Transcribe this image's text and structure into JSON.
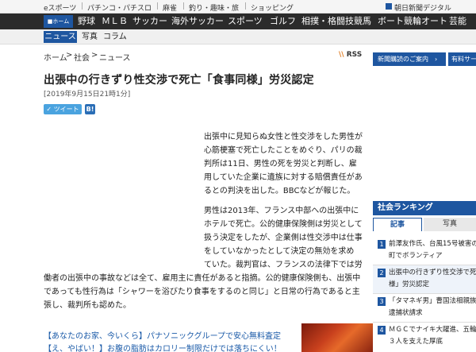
{
  "topbar": {
    "links": [
      "eスポーツ",
      "パチンコ・パチスロ",
      "麻雀",
      "釣り・趣味・旅",
      "ショッピング"
    ],
    "right_link": "朝日新聞デジタル"
  },
  "nav": {
    "home_label": "ホーム",
    "items": [
      "野球",
      "ＭＬＢ",
      "サッカー",
      "海外サッカー",
      "スポーツ",
      "ゴルフ",
      "相撲・格闘技",
      "競馬",
      "ボート競輪オート",
      "芸能"
    ]
  },
  "subnav": {
    "items": [
      "ニュース",
      "写真",
      "コラム"
    ]
  },
  "breadcrumb": [
    "ホーム",
    "社会",
    "ニュース"
  ],
  "rss_label": "RSS",
  "article": {
    "title": "出張中の行きずり性交渉で死亡「食事同様」労災認定",
    "date": "[2019年9月15日21時1分]",
    "tweet_label": "ツイート",
    "hatena_label": "B!",
    "paragraph1": [
      "出張中に見知らぬ女性と性交渉をした男性が",
      "心筋梗塞で死亡したことをめぐり、パリの裁",
      "判所は11日、男性の死を労災と判断し、雇",
      "用していた企業に遺族に対する賠償責任があ",
      "るとの判決を出した。BBCなどが報じた。"
    ],
    "paragraph2": [
      "男性は2013年、フランス中部への出張中に",
      "ホテルで死亡。公的健康保険側は労災として",
      "扱う決定をしたが、企業側は性交渉中は仕事",
      "をしていなかったとして決定の無効を求め",
      "ていた。裁判官は、フランスの法律下では労",
      "働者の出張中の事故などは全て、雇用主に責任があると指摘。公的健康保険側も、出張中",
      "であっても性行為は「シャワーを浴びたり食事をするのと同じ」と日常の行為であると主",
      "張し、裁判所も認めた。"
    ]
  },
  "ads": [
    "【あなたのお家、今いくら】パナソニックグループで安心無料査定",
    "【え、やばい！】お腹の脂肪はカロリー制限だけでは落ちにくい！"
  ],
  "sidebar": {
    "button1": "新聞購読のご案内　›",
    "button2": "有料サービス",
    "ranking_title": "社会ランキング",
    "tabs": [
      "記事",
      "写真"
    ],
    "ranking": [
      {
        "num": "1",
        "lines": [
          "前澤友作氏、台風15号被害の",
          "町でボランティア"
        ]
      },
      {
        "num": "2",
        "lines": [
          "出張中の行きずり性交渉で死",
          "様」労災認定"
        ]
      },
      {
        "num": "3",
        "lines": [
          "「タマネギ男」曹国法相親族",
          "逮捕状請求"
        ]
      },
      {
        "num": "4",
        "lines": [
          "ＭＧＣでナイキ大躍進、五輪",
          "３人を支えた厚底"
        ]
      }
    ]
  },
  "colors": {
    "nav_bg": "#2b2b2b",
    "brand_blue": "#1e56a0",
    "link_blue": "#1a5aa8",
    "tweet_blue": "#4aa3df"
  }
}
